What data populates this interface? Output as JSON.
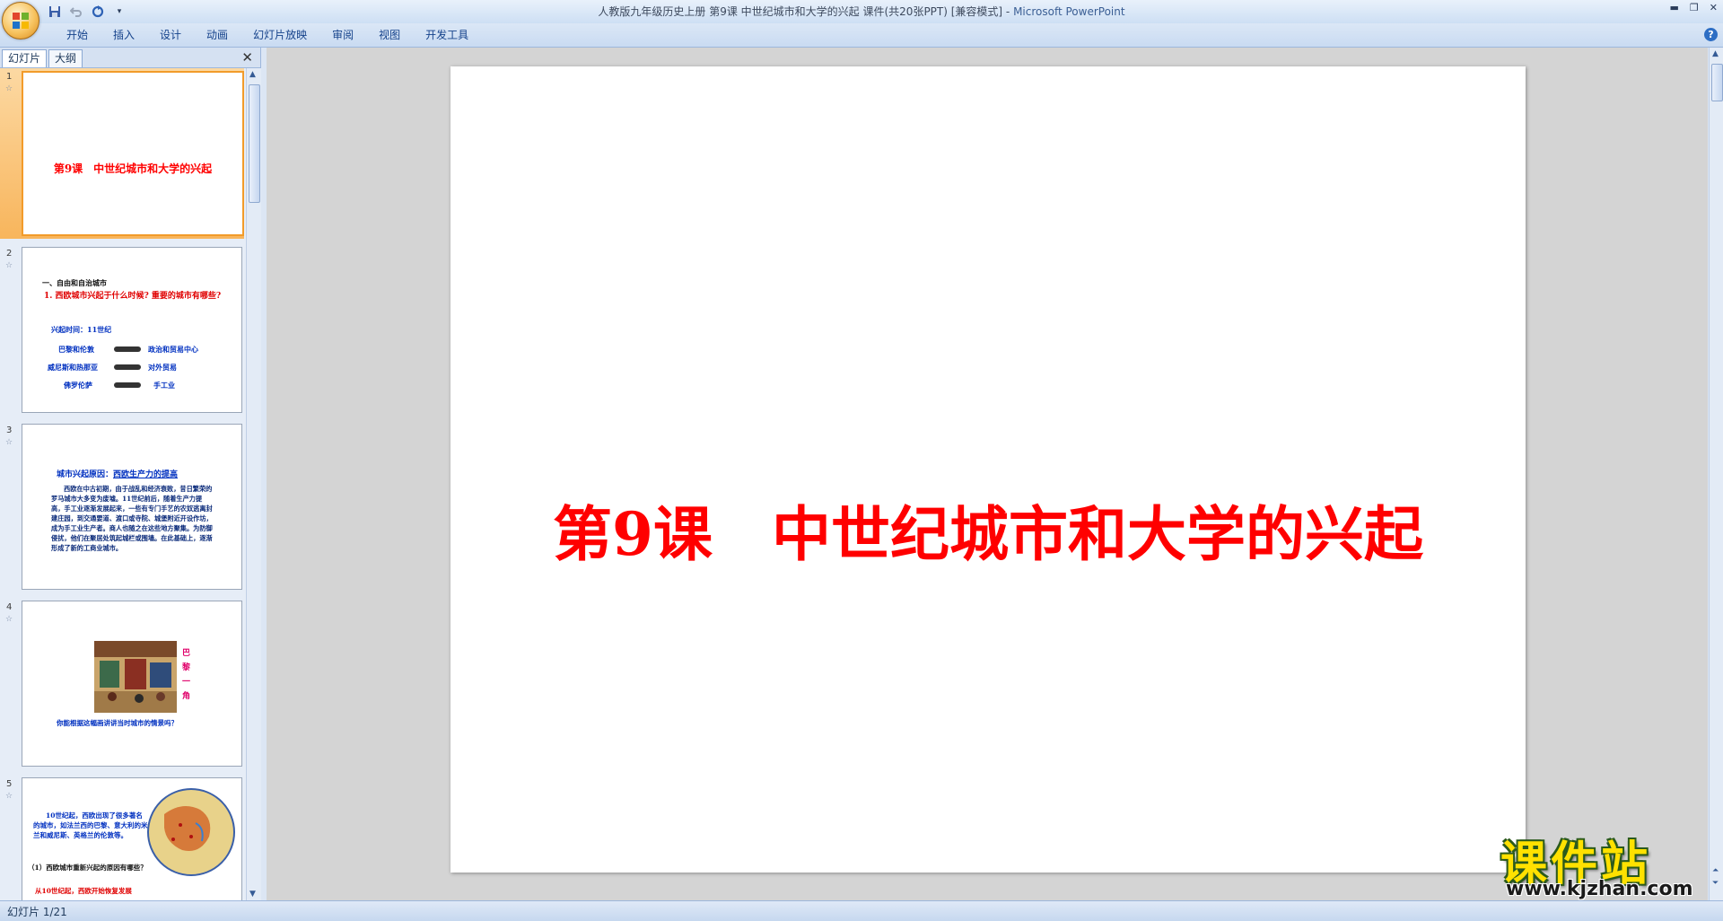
{
  "window": {
    "title": "人教版九年级历史上册 第9课 中世纪城市和大学的兴起 课件(共20张PPT) [兼容模式]",
    "separator": " - ",
    "app_name": "Microsoft PowerPoint"
  },
  "ribbon_tabs": [
    "开始",
    "插入",
    "设计",
    "动画",
    "幻灯片放映",
    "审阅",
    "视图",
    "开发工具"
  ],
  "panel": {
    "tab_slides": "幻灯片",
    "tab_outline": "大纲",
    "close": "✕"
  },
  "thumbnails": [
    {
      "num": "1",
      "title": "第9课　中世纪城市和大学的兴起"
    },
    {
      "num": "2",
      "heading": "一、自由和自治城市",
      "question": "1. 西欧城市兴起于什么时候? 重要的城市有哪些?",
      "time": "兴起时间：11世纪",
      "rows": [
        {
          "city": "巴黎和伦敦",
          "role": "政治和贸易中心"
        },
        {
          "city": "威尼斯和热那亚",
          "role": "对外贸易"
        },
        {
          "city": "佛罗伦萨",
          "role": "手工业"
        }
      ]
    },
    {
      "num": "3",
      "heading_a": "城市兴起原因：",
      "heading_b": "西欧生产力的提高",
      "body": "西欧在中古初期，由于战乱和经济衰败，昔日繁荣的罗马城市大多变为废墟。11世纪前后，随着生产力提高，手工业逐渐发展起来，一些有专门手艺的农奴逃离封建庄园，到交通要道、渡口或寺院、城堡附近开设作坊，成为手工业生产者。商人也随之在这些地方聚集。为防御侵扰，他们在聚居处筑起城栏或围墙。在此基础上，逐渐形成了新的工商业城市。"
    },
    {
      "num": "4",
      "caption_side": "巴黎一角",
      "caption": "你能根据这幅画讲讲当时城市的情景吗？"
    },
    {
      "num": "5",
      "body": "10世纪起，西欧出现了很多著名的城市，如法兰西的巴黎、意大利的米兰和威尼斯、英格兰的伦敦等。",
      "question": "（1）西欧城市重新兴起的原因有哪些？",
      "answer": "从10世纪起，西欧开始恢复发展"
    }
  ],
  "slide": {
    "title": "第9课　中世纪城市和大学的兴起"
  },
  "watermark": {
    "brand": "课件站",
    "url": "www.kjzhan.com"
  },
  "status": {
    "slide_indicator": "幻灯片 1/21"
  },
  "colors": {
    "title_red": "#ff0000",
    "ribbon_text": "#15428b",
    "selection_orange": "#f8b55c"
  }
}
